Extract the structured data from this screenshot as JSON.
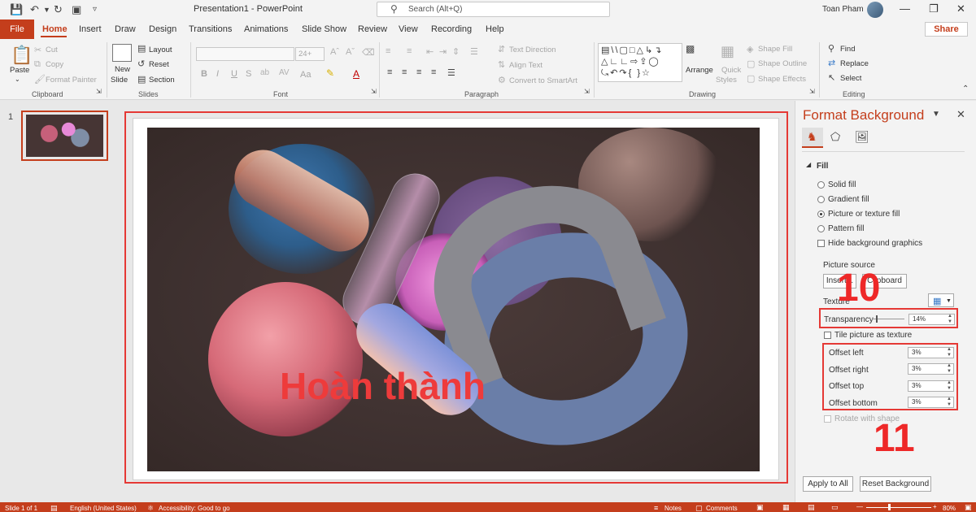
{
  "titlebar": {
    "doc_title": "Presentation1  -  PowerPoint",
    "search_placeholder": "Search (Alt+Q)",
    "user_name": "Toan Pham"
  },
  "tabs": [
    "File",
    "Home",
    "Insert",
    "Draw",
    "Design",
    "Transitions",
    "Animations",
    "Slide Show",
    "Review",
    "View",
    "Recording",
    "Help"
  ],
  "share_label": "Share",
  "ribbon": {
    "clipboard": {
      "paste": "Paste",
      "cut": "Cut",
      "copy": "Copy",
      "format_painter": "Format Painter",
      "label": "Clipboard"
    },
    "slides": {
      "new_slide": "New",
      "new_slide2": "Slide",
      "layout": "Layout",
      "reset": "Reset",
      "section": "Section",
      "label": "Slides"
    },
    "font": {
      "size": "24+",
      "label": "Font",
      "bold": "B",
      "italic": "I",
      "underline": "U",
      "strike": "S",
      "case": "Aa",
      "label_A": "A"
    },
    "paragraph": {
      "text_direction": "Text Direction",
      "align_text": "Align Text",
      "convert_smartart": "Convert to SmartArt",
      "label": "Paragraph"
    },
    "drawing": {
      "arrange": "Arrange",
      "quick_styles": "Quick",
      "quick_styles2": "Styles",
      "shape_fill": "Shape Fill",
      "shape_outline": "Shape Outline",
      "shape_effects": "Shape Effects",
      "label": "Drawing"
    },
    "editing": {
      "find": "Find",
      "replace": "Replace",
      "select": "Select",
      "label": "Editing"
    }
  },
  "thumbnails": {
    "slide_number": "1"
  },
  "slide": {
    "caption": "Hoàn thành"
  },
  "format_pane": {
    "title": "Format Background",
    "fill_header": "Fill",
    "options": {
      "solid": "Solid fill",
      "gradient": "Gradient fill",
      "picture": "Picture or texture fill",
      "pattern": "Pattern fill",
      "hide_graphics": "Hide background graphics"
    },
    "picture_source": "Picture source",
    "insert_btn": "Insert...",
    "clipboard_btn": "Clipboard",
    "texture_label": "Texture",
    "transparency_label": "Transparency",
    "transparency_value": "14%",
    "tile_label": "Tile picture as texture",
    "offsets": [
      {
        "label": "Offset left",
        "value": "3%"
      },
      {
        "label": "Offset right",
        "value": "3%"
      },
      {
        "label": "Offset top",
        "value": "3%"
      },
      {
        "label": "Offset bottom",
        "value": "3%"
      }
    ],
    "rotate_label": "Rotate with shape",
    "apply_all": "Apply to All",
    "reset_bg": "Reset Background"
  },
  "annotations": {
    "step10": "10",
    "step11": "11"
  },
  "statusbar": {
    "slide_info": "Slide 1 of 1",
    "language": "English (United States)",
    "accessibility": "Accessibility: Good to go",
    "notes": "Notes",
    "comments": "Comments",
    "zoom": "80%"
  },
  "colors": {
    "accent": "#c43e1c",
    "highlight": "#e53935",
    "caption": "#ee3b3b"
  }
}
